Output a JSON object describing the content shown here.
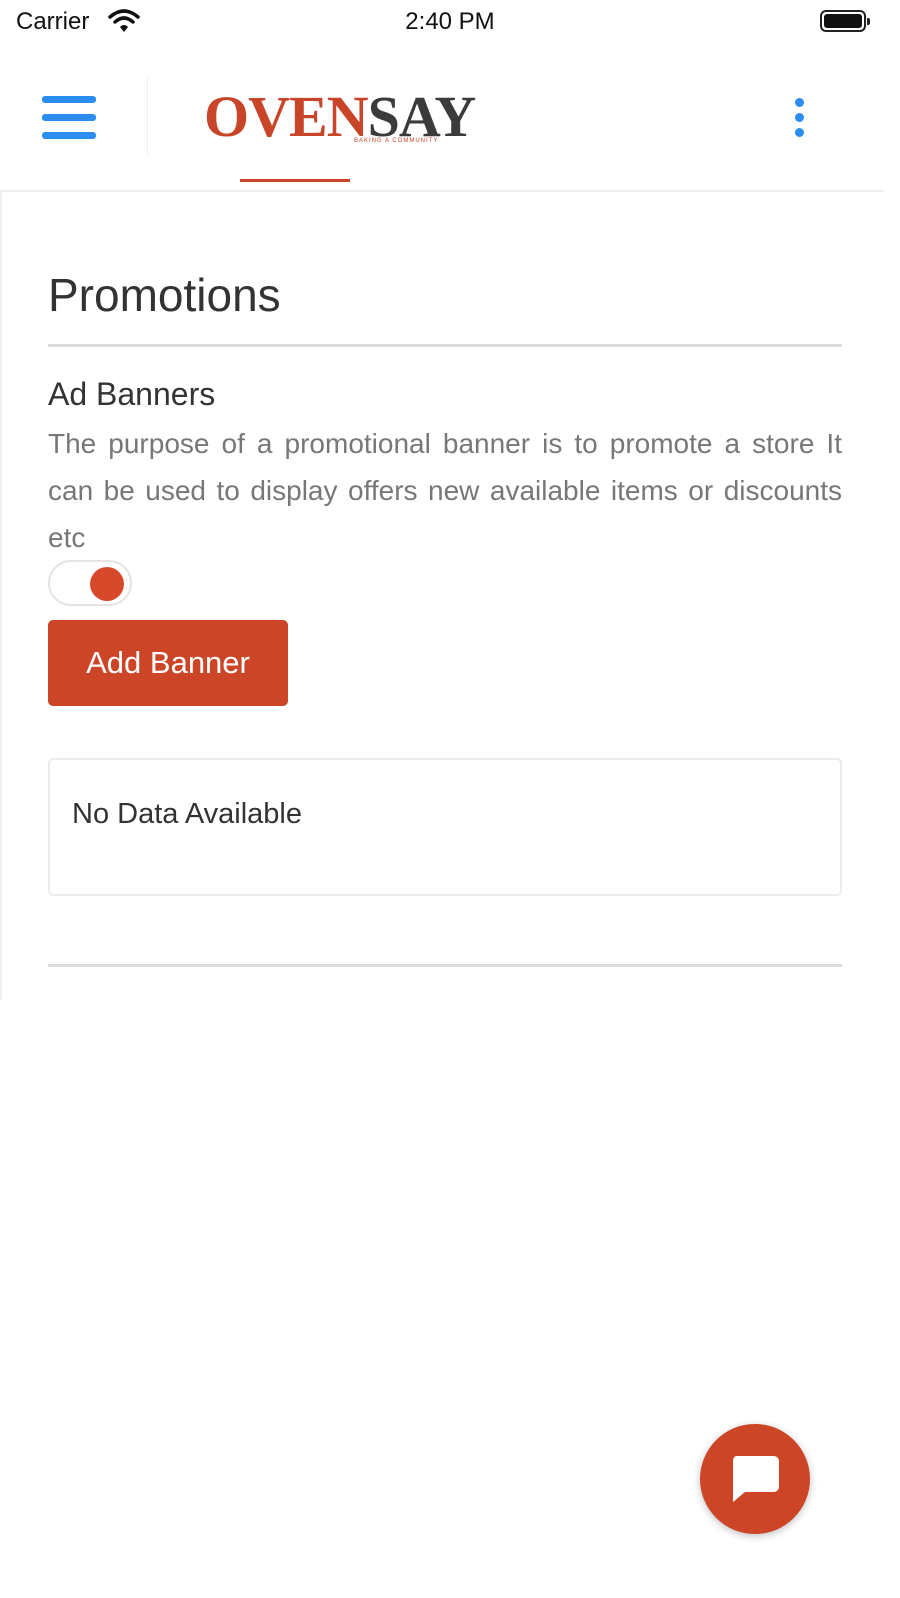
{
  "status_bar": {
    "carrier": "Carrier",
    "time": "2:40 PM",
    "wifi_icon": "wifi-icon",
    "battery_icon": "battery-icon"
  },
  "header": {
    "menu_icon": "hamburger-menu-icon",
    "logo": {
      "text_part1": "O",
      "text_part2": "VEN",
      "text_part3": "SAY",
      "tagline": "BAKING A COMMUNITY"
    },
    "overflow_icon": "more-vertical-icon"
  },
  "page": {
    "title": "Promotions",
    "ad_banners": {
      "title": "Ad Banners",
      "description": "The purpose of a promotional banner is to promote a store It can be used to display offers new available items or discounts etc",
      "toggle_enabled": true,
      "add_button_label": "Add Banner",
      "empty_message": "No Data Available"
    }
  },
  "chat_fab": {
    "icon": "chat-bubble-icon"
  },
  "colors": {
    "accent": "#cc4527",
    "link_blue": "#2d8cf0",
    "divider": "#dcdcdc"
  }
}
